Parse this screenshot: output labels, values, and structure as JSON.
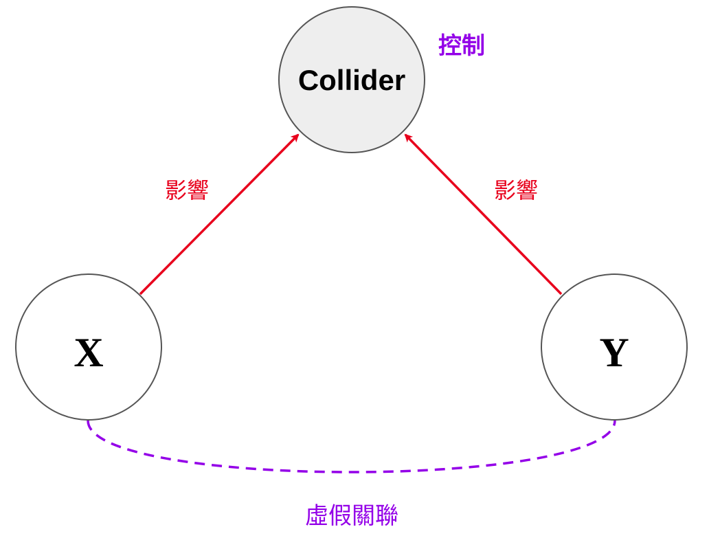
{
  "nodes": {
    "collider": {
      "label": "Collider",
      "fill": "#eeeeee"
    },
    "x": {
      "label": "X",
      "fill": "#ffffff"
    },
    "y": {
      "label": "Y",
      "fill": "#ffffff"
    }
  },
  "edges": {
    "x_to_collider": {
      "label": "影響",
      "color": "#e8001c"
    },
    "y_to_collider": {
      "label": "影響",
      "color": "#e8001c"
    },
    "x_y_spurious": {
      "label": "虛假關聯",
      "color": "#9400e8"
    }
  },
  "annotations": {
    "control": {
      "label": "控制",
      "color": "#9400e8"
    }
  },
  "colors": {
    "node_stroke": "#555555",
    "text": "#000000"
  }
}
